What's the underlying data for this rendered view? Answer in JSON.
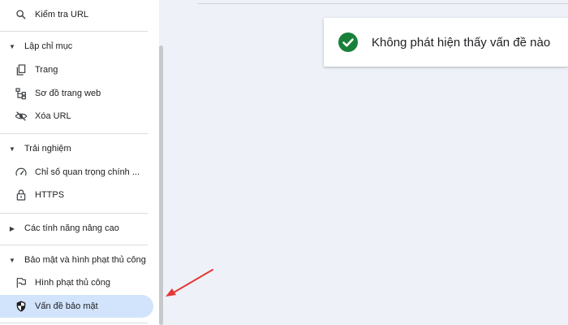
{
  "sidebar": {
    "url_inspection": "Kiểm tra URL",
    "sections": [
      {
        "title": "Lập chỉ mục",
        "items": [
          "Trang",
          "Sơ đồ trang web",
          "Xóa URL"
        ]
      },
      {
        "title": "Trải nghiệm",
        "items": [
          "Chỉ số quan trọng chính ...",
          "HTTPS"
        ]
      },
      {
        "title": "Các tính năng nâng cao",
        "items": []
      },
      {
        "title": "Bảo mật và hình phạt thủ công",
        "items": [
          "Hình phạt thủ công",
          "Vấn đề bảo mật"
        ]
      }
    ],
    "active_item": "Vấn đề bảo mật"
  },
  "status": {
    "message": "Không phát hiện thấy vấn đề nào",
    "icon": "check-circle-icon",
    "color": "#188038"
  },
  "annotation": {
    "arrow_color": "#e53935"
  },
  "theme": {
    "active_bg": "#d2e3fc",
    "page_bg": "#eef2f8"
  }
}
